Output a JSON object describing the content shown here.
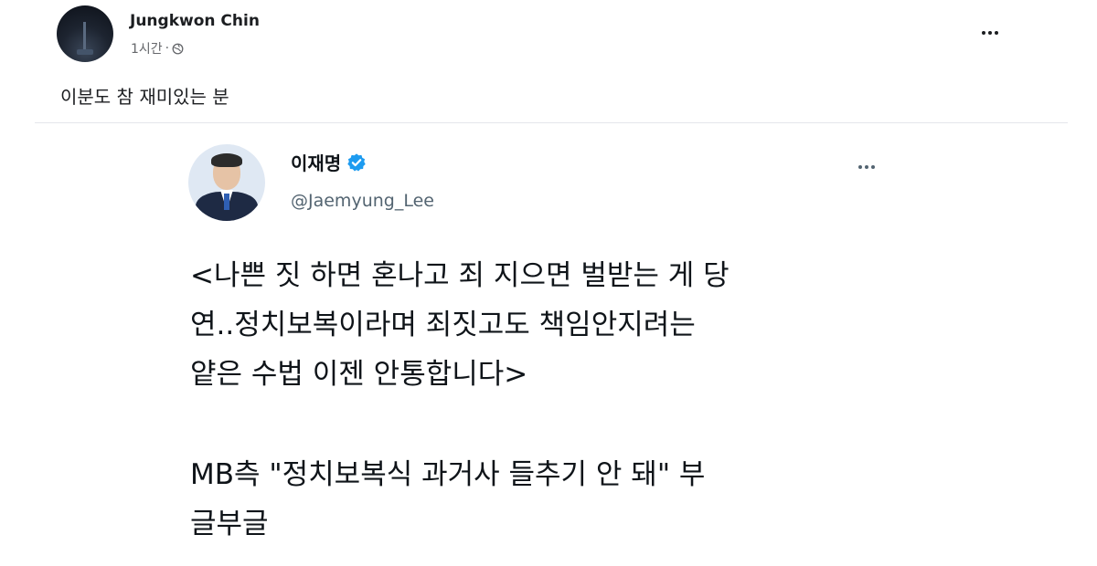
{
  "post": {
    "author": "Jungkwon Chin",
    "time": "1시간",
    "separator": "·",
    "caption": "이분도 참 재미있는 분",
    "privacy_icon": "globe-icon",
    "more_icon": "more-horizontal-icon"
  },
  "tweet": {
    "name": "이재명",
    "handle": "@Jaemyung_Lee",
    "verified_color": "#1d9bf0",
    "body_lines": [
      "<나쁜 짓 하면 혼나고 죄 지으면 벌받는 게 당",
      "연..정치보복이라며 죄짓고도 책임안지려는",
      "얕은 수법 이젠 안통합니다>"
    ],
    "body2_lines": [
      "MB측 \"정치보복식 과거사 들추기 안 돼\" 부",
      "글부글"
    ]
  }
}
